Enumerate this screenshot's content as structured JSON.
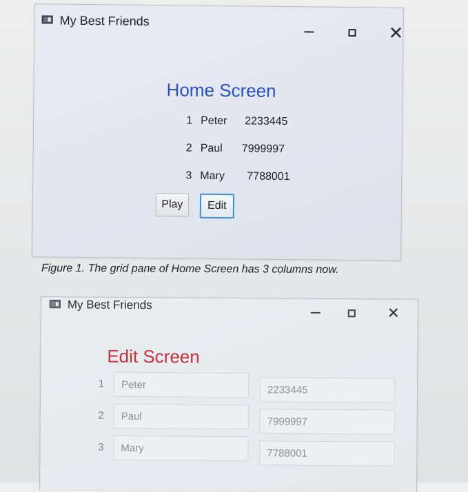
{
  "home_window": {
    "title": "My Best Friends",
    "heading": "Home Screen",
    "friends": [
      {
        "num": "1",
        "name": "Peter",
        "phone": "2233445"
      },
      {
        "num": "2",
        "name": "Paul",
        "phone": "7999997"
      },
      {
        "num": "3",
        "name": "Mary",
        "phone": "7788001"
      }
    ],
    "buttons": {
      "play": "Play",
      "edit": "Edit"
    }
  },
  "caption": "Figure 1. The grid pane of Home Screen has 3 columns now.",
  "edit_window": {
    "title": "My Best Friends",
    "heading": "Edit Screen",
    "rows": [
      {
        "num": "1",
        "name": "Peter",
        "phone": "2233445"
      },
      {
        "num": "2",
        "name": "Paul",
        "phone": "7999997"
      },
      {
        "num": "3",
        "name": "Mary",
        "phone": "7788001"
      }
    ]
  },
  "window_controls": {
    "close": "✕"
  },
  "icons": {
    "app": "app-window-icon",
    "minimize": "minimize-icon",
    "maximize": "maximize-icon",
    "close": "close-icon"
  },
  "colors": {
    "home_heading": "#2452c4",
    "edit_heading": "#c9303a",
    "focus_border": "#3d8fd9"
  }
}
